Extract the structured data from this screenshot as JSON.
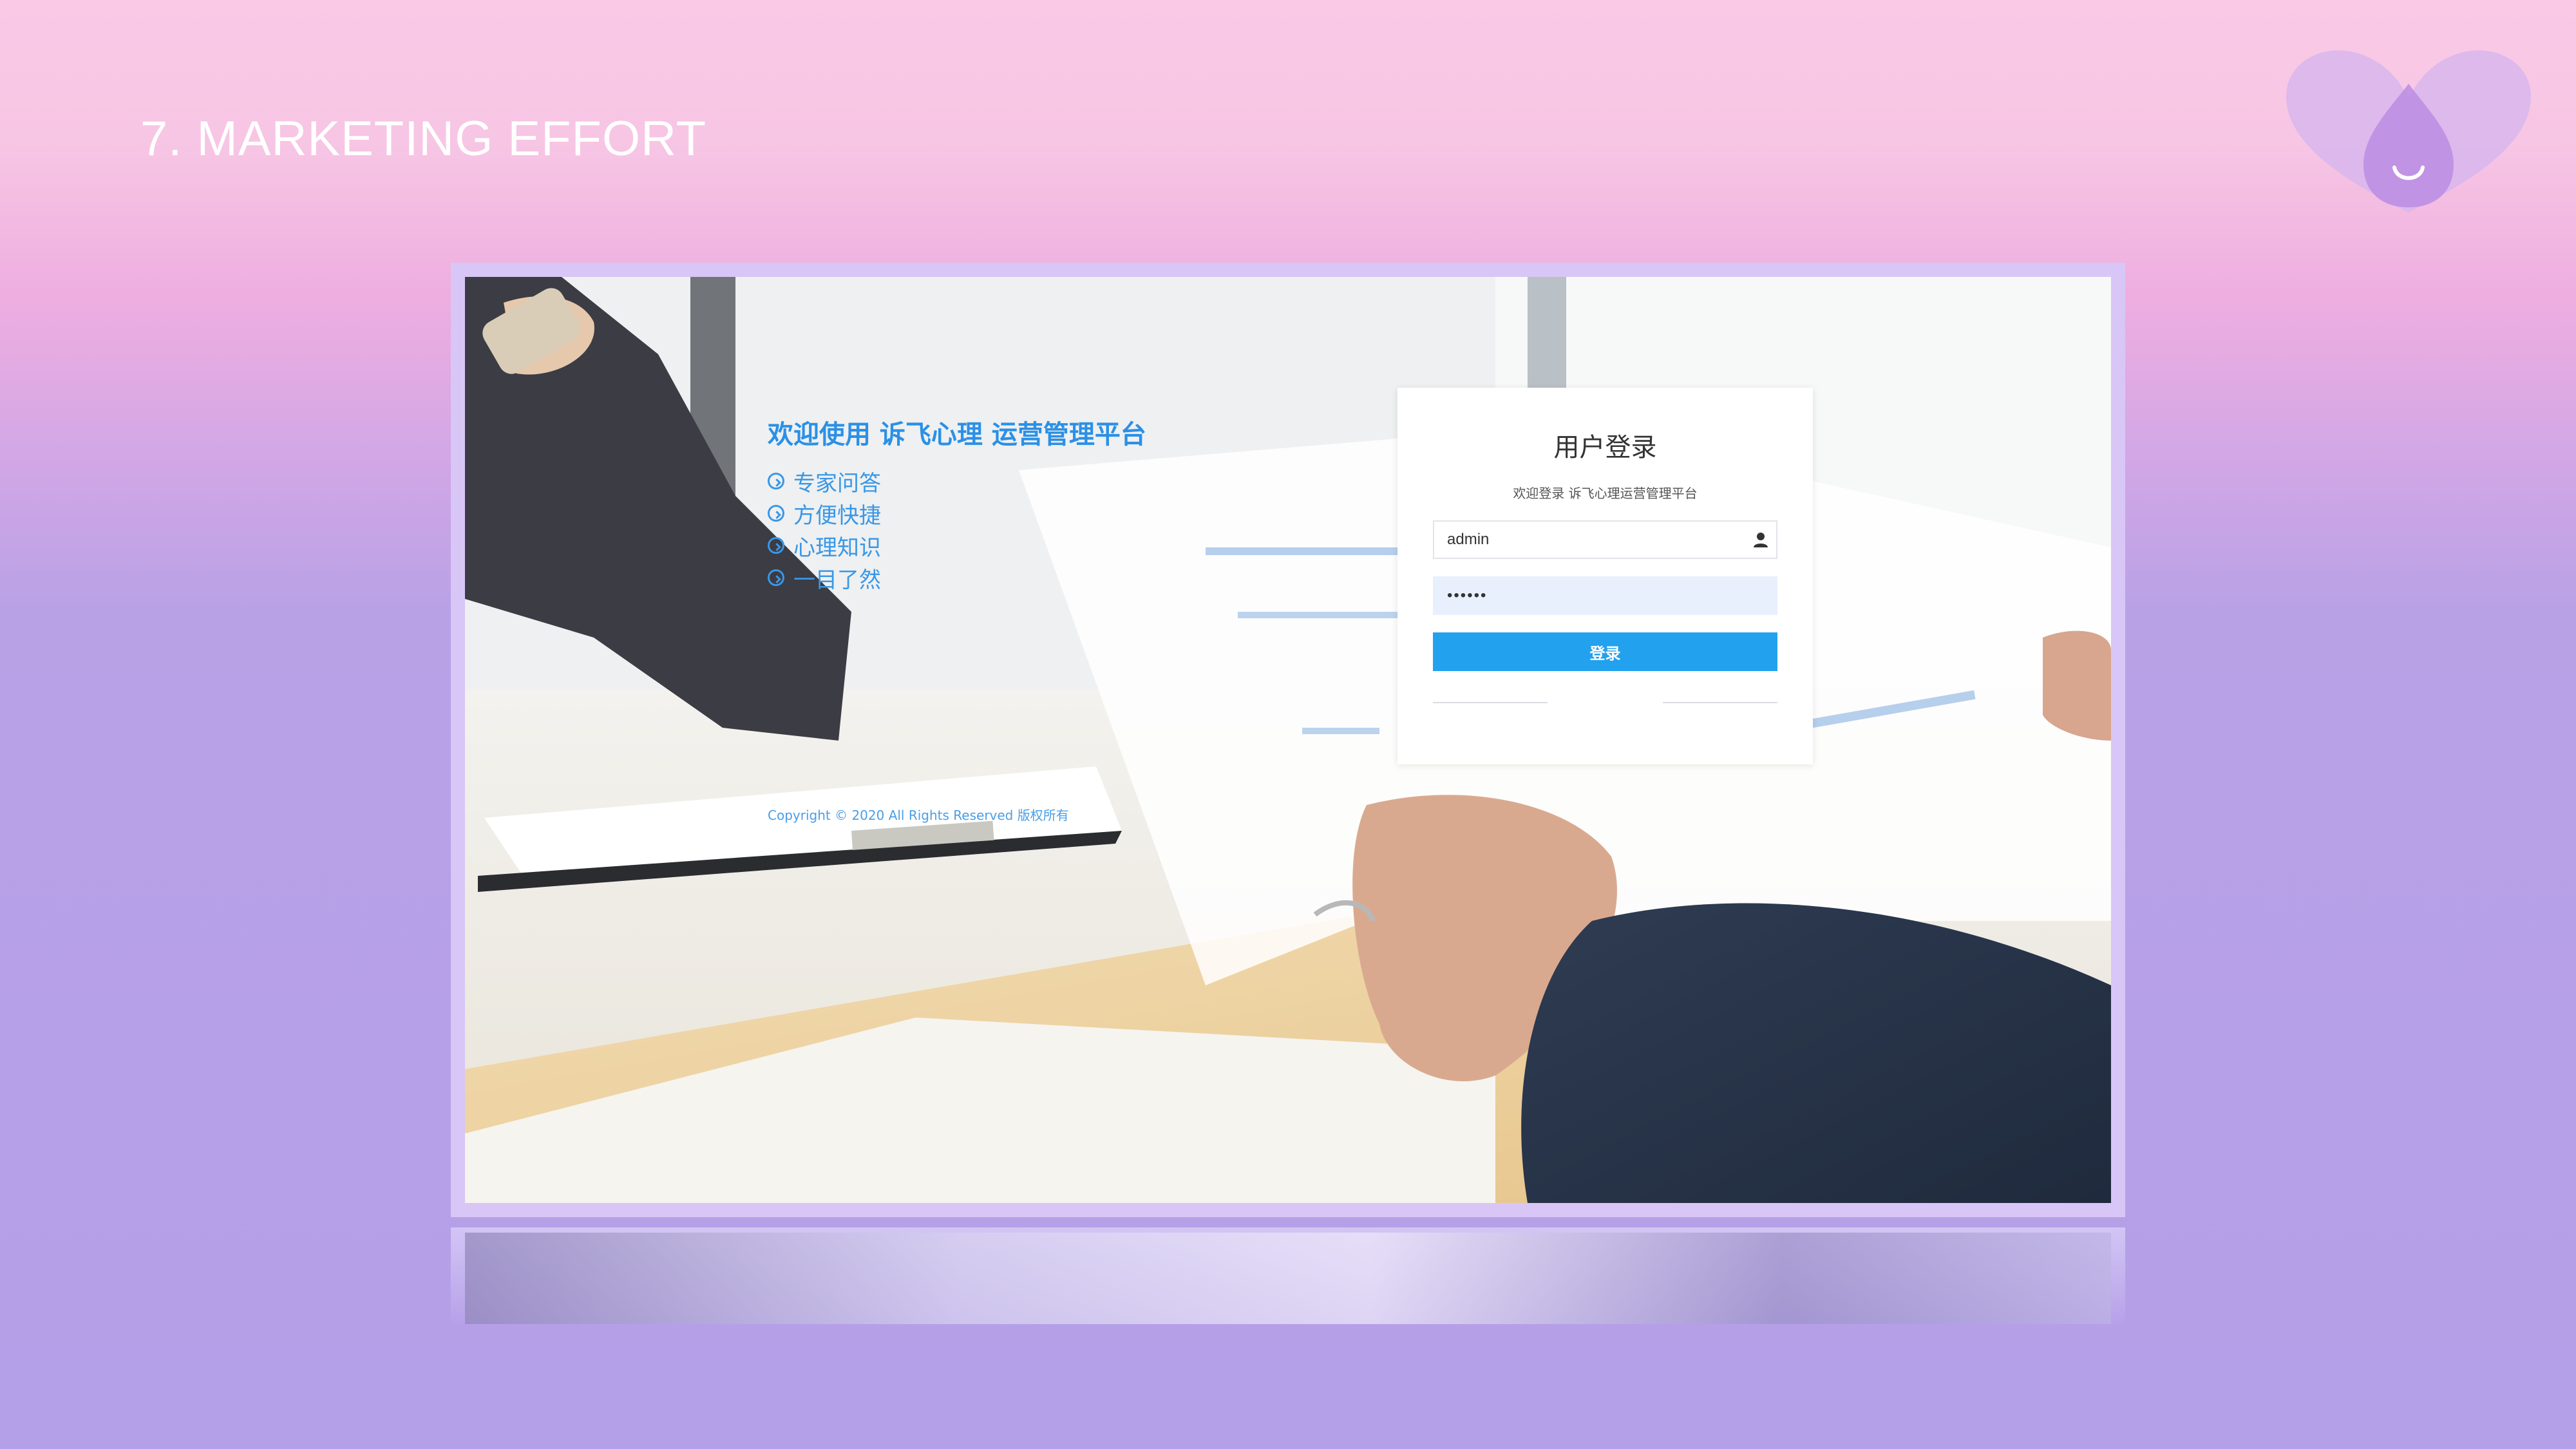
{
  "slide": {
    "title": "7. MARKETING EFFORT",
    "logo_icon": "heart-drop-smile-icon"
  },
  "screenshot": {
    "welcome": "欢迎使用 诉飞心理 运营管理平台",
    "features": [
      "专家问答",
      "方便快捷",
      "心理知识",
      "一目了然"
    ],
    "feature_icon": "circle-arrow-right-icon",
    "copyright": "Copyright © 2020 All Rights Reserved 版权所有",
    "login": {
      "title": "用户登录",
      "subtitle": "欢迎登录 诉飞心理运营管理平台",
      "username_value": "admin",
      "username_icon": "user-icon",
      "password_value": "••••••",
      "button_label": "登录"
    },
    "colors": {
      "accent_blue": "#22a1ee",
      "text_blue": "#2b90e6",
      "frame_lavender": "#d8c6f6"
    }
  }
}
